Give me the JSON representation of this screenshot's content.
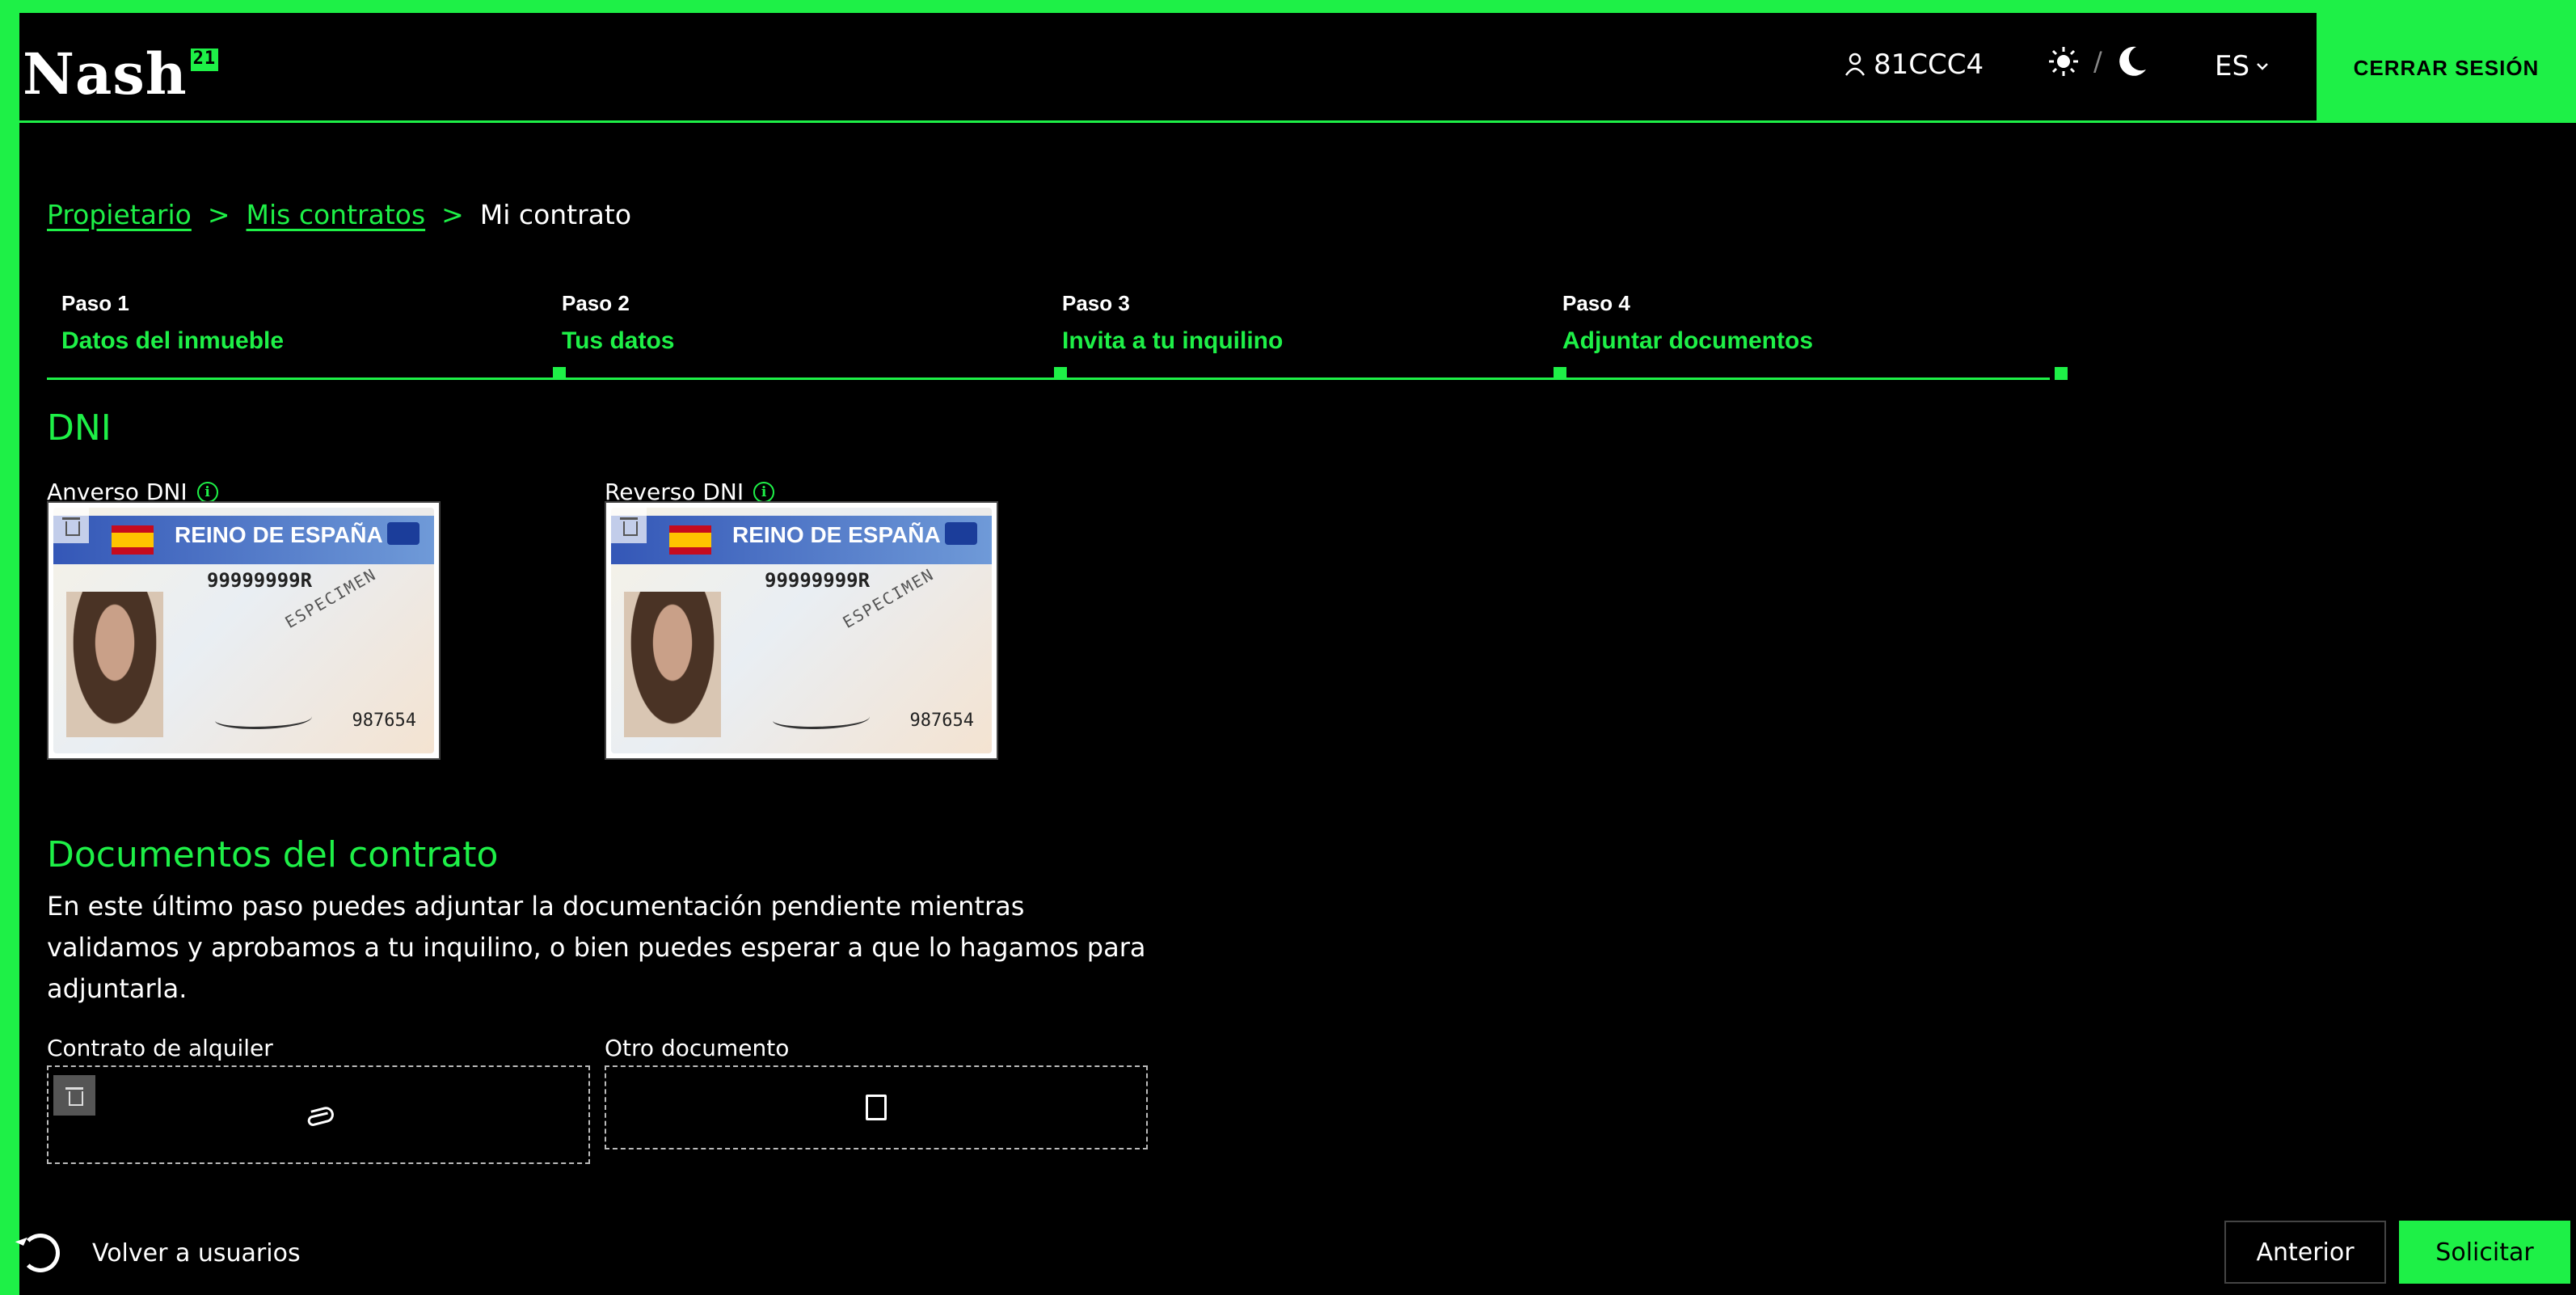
{
  "header": {
    "logo": "Nash",
    "logo_badge": "21",
    "user": "81CCC4",
    "theme_separator": "/",
    "language": "ES",
    "logout": "CERRAR SESIÓN"
  },
  "breadcrumb": {
    "items": [
      "Propietario",
      "Mis contratos",
      "Mi contrato"
    ],
    "separator": ">"
  },
  "steps": [
    {
      "num": "Paso 1",
      "name": "Datos del inmueble"
    },
    {
      "num": "Paso 2",
      "name": "Tus datos"
    },
    {
      "num": "Paso 3",
      "name": "Invita a tu inquilino"
    },
    {
      "num": "Paso 4",
      "name": "Adjuntar documentos"
    }
  ],
  "dni": {
    "title": "DNI",
    "front_label": "Anverso DNI",
    "back_label": "Reverso DNI",
    "card_title": "REINO DE ESPAÑA",
    "card_number": "99999999R",
    "card_code": "987654",
    "card_specimen": "ESPECIMEN"
  },
  "documents": {
    "title": "Documentos del contrato",
    "description": "En este último paso puedes adjuntar la documentación pendiente mientras validamos y aprobamos a tu inquilino, o bien puedes esperar a que lo hagamos para adjuntarla.",
    "rental_label": "Contrato de alquiler",
    "other_label": "Otro documento"
  },
  "footer": {
    "back_users": "Volver a usuarios",
    "prev": "Anterior",
    "submit": "Solicitar"
  },
  "colors": {
    "accent": "#1ef047",
    "background": "#000000"
  },
  "icons": [
    "user-icon",
    "sun-icon",
    "moon-icon",
    "chevron-down-icon",
    "info-icon",
    "trash-icon",
    "paperclip-icon",
    "pdf-file-icon",
    "refresh-icon"
  ]
}
